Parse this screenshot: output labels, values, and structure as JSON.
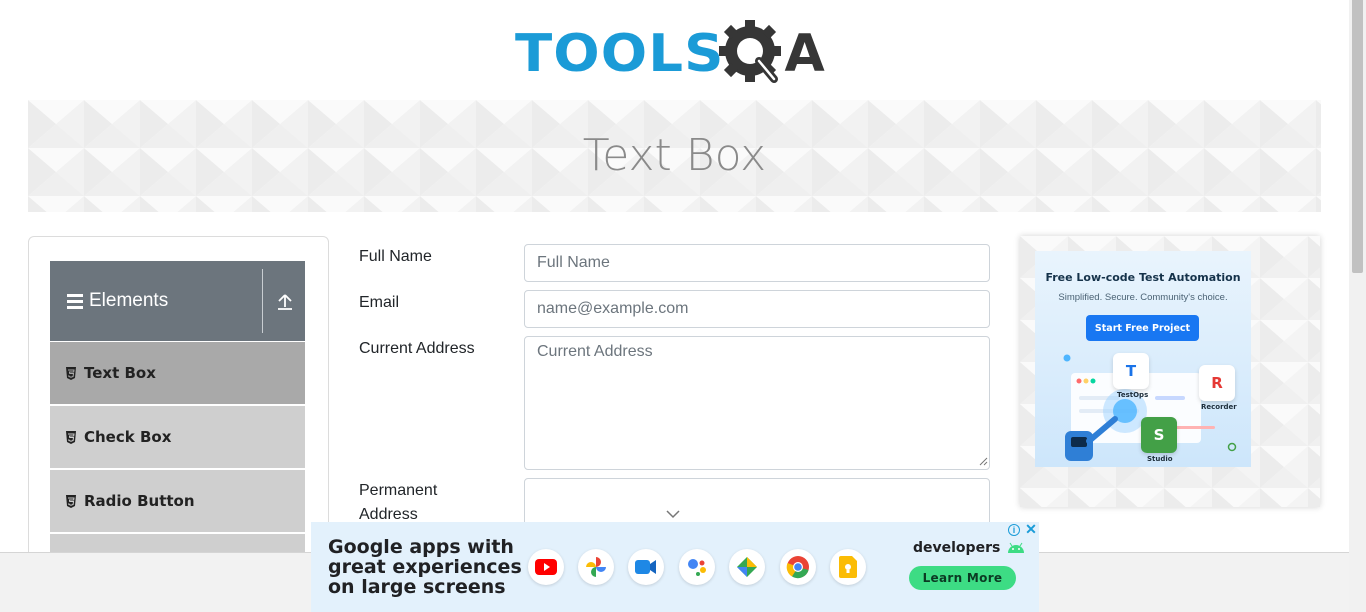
{
  "logo": {
    "tools_text": "TOOLS",
    "qa_text": "A",
    "colors": {
      "tools": "#1b9bd7",
      "qa": "#363636"
    }
  },
  "banner": {
    "title": "Text Box"
  },
  "sidebar": {
    "group_title": "Elements",
    "items": [
      {
        "label": "Text Box",
        "active": true
      },
      {
        "label": "Check Box",
        "active": false
      },
      {
        "label": "Radio Button",
        "active": false
      }
    ]
  },
  "form": {
    "full_name": {
      "label": "Full Name",
      "placeholder": "Full Name",
      "value": ""
    },
    "email": {
      "label": "Email",
      "placeholder": "name@example.com",
      "value": ""
    },
    "current_address": {
      "label": "Current Address",
      "placeholder": "Current Address",
      "value": ""
    },
    "permanent_address": {
      "label_line1": "Permanent",
      "label_line2": "Address",
      "value": ""
    }
  },
  "side_ad": {
    "title": "Free Low-code Test Automation",
    "subtitle": "Simplified. Secure. Community's choice.",
    "button": "Start Free Project",
    "tiles": [
      {
        "letter": "T",
        "label": "TestOps",
        "color": "#1a73e8"
      },
      {
        "letter": "R",
        "label": "Recorder",
        "color": "#e53935"
      },
      {
        "letter": "S",
        "label": "Studio",
        "color": "#43a047"
      }
    ]
  },
  "bottom_ad": {
    "headline_line1": "Google apps with",
    "headline_line2": "great experiences",
    "headline_line3": "on large screens",
    "brand": "developers",
    "button": "Learn More",
    "adchoices": "i",
    "close": "✕",
    "apps": [
      "youtube-icon",
      "photos-icon",
      "meet-icon",
      "assistant-icon",
      "maps-icon",
      "chrome-icon",
      "keep-icon"
    ]
  }
}
